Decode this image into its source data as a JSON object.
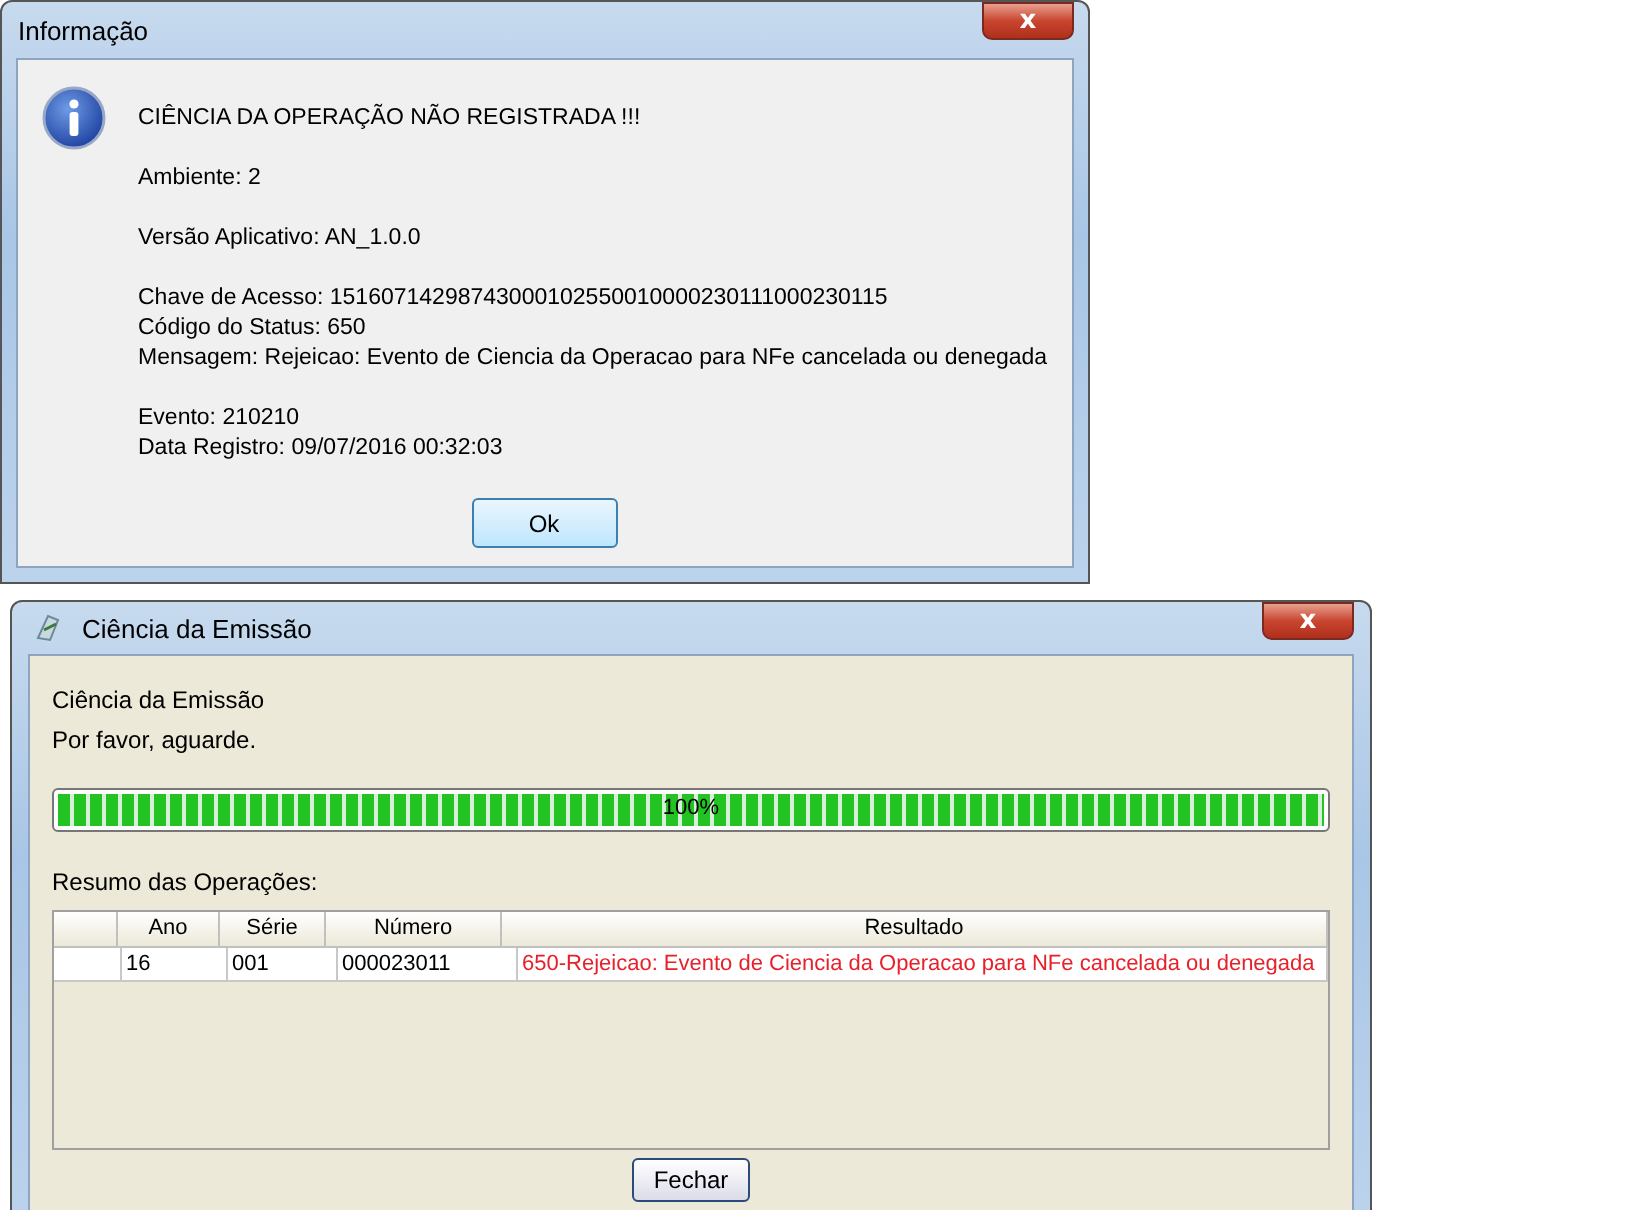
{
  "info_dialog": {
    "title": "Informação",
    "close": "x",
    "groups": [
      [
        "CIÊNCIA DA OPERAÇÃO NÃO REGISTRADA !!!"
      ],
      [
        "Ambiente: 2"
      ],
      [
        "Versão Aplicativo: AN_1.0.0"
      ],
      [
        "Chave de Acesso: 15160714298743000102550010000230111000230115",
        "Código do Status: 650",
        "Mensagem: Rejeicao: Evento de Ciencia da Operacao para NFe cancelada ou denegada"
      ],
      [
        "Evento: 210210",
        "Data Registro: 09/07/2016 00:32:03"
      ]
    ],
    "button": "Ok"
  },
  "progress_window": {
    "title": "Ciência da Emissão",
    "close": "x",
    "heading": "Ciência da Emissão",
    "subheading": "Por favor, aguarde.",
    "progress": {
      "level": 1,
      "label": "100%"
    },
    "summary_label": "Resumo das Operações:",
    "table": {
      "columns": [
        "",
        "Ano",
        "Série",
        "Número",
        "Resultado"
      ],
      "rows": [
        {
          "rejected": true,
          "cells": [
            "",
            "16",
            "001",
            "000023011",
            "650-Rejeicao: Evento de Ciencia da Operacao para NFe cancelada ou denegada"
          ]
        }
      ]
    },
    "button": "Fechar"
  }
}
